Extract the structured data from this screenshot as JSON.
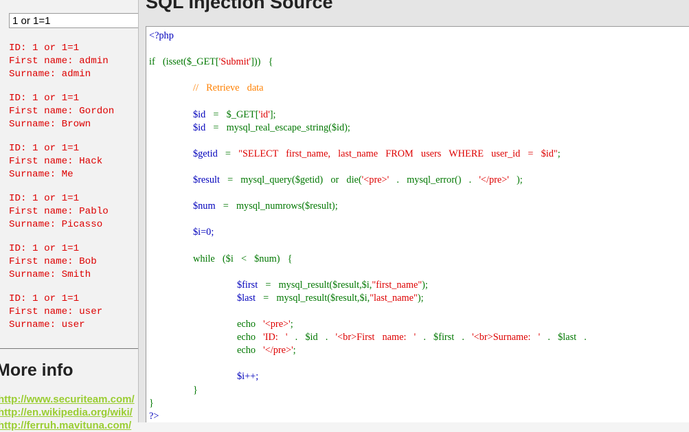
{
  "search": {
    "value": "1 or 1=1"
  },
  "results": [
    {
      "id": "ID: 1 or 1=1",
      "first": "First name: admin",
      "surname": "Surname: admin"
    },
    {
      "id": "ID: 1 or 1=1",
      "first": "First name: Gordon",
      "surname": "Surname: Brown"
    },
    {
      "id": "ID: 1 or 1=1",
      "first": "First name: Hack",
      "surname": "Surname: Me"
    },
    {
      "id": "ID: 1 or 1=1",
      "first": "First name: Pablo",
      "surname": "Surname: Picasso"
    },
    {
      "id": "ID: 1 or 1=1",
      "first": "First name: Bob",
      "surname": "Surname: Smith"
    },
    {
      "id": "ID: 1 or 1=1",
      "first": "First name: user",
      "surname": "Surname: user"
    }
  ],
  "more_info": {
    "heading": "More info",
    "links": [
      "http://www.securiteam.com/",
      "http://en.wikipedia.org/wiki/",
      "http://ferruh.mavituna.com/"
    ]
  },
  "popup": {
    "title": "SQL Injection Source",
    "code": {
      "php_open": "<?php",
      "if_kw": "if",
      "if_rest": "  (isset($_GET[",
      "submit_str": "'Submit'",
      "if_end": "]))  {",
      "comment": "//  Retrieve  data",
      "id1_var": "$id",
      "id1_mid": "  =  $_GET[",
      "id1_str": "'id'",
      "id1_end": "];",
      "id2_var": "$id",
      "id2_rest": "  =  mysql_real_escape_string($id);",
      "getid_var": "$getid",
      "getid_eq": "  =  ",
      "getid_str": "\"SELECT  first_name,  last_name  FROM  users  WHERE  user_id  =  $id\"",
      "getid_end": ";",
      "result_var": "$result",
      "result_mid": "  =  mysql_query($getid)  ",
      "result_or": "or",
      "result_die": "  die(",
      "result_pre": "'<pre>'",
      "result_concat": "  .  mysql_error()  .  ",
      "result_pre_close": "'</pre>'",
      "result_end": "  );",
      "num_var": "$num",
      "num_rest": "  =  mysql_numrows($result);",
      "i_init": "$i=0;",
      "while_kw": "while",
      "while_rest": "  ($i  <  $num)  {",
      "first_var": "$first",
      "first_mid": "  =  mysql_result($result,$i,",
      "first_str": "\"first_name\"",
      "first_end": ");",
      "last_var": "$last",
      "last_mid": "  =  mysql_result($result,$i,",
      "last_str": "\"last_name\"",
      "last_end": ");",
      "echo_kw": "echo",
      "echo1_str": "  '<pre>'",
      "echo1_end": ";",
      "echo2_str": "  'ID:  '",
      "echo2_a": "  .  $id  .  ",
      "echo2_str2": "'<br>First  name:  '",
      "echo2_b": "  .  $first  .  ",
      "echo2_str3": "'<br>Surname:  '",
      "echo2_end": "  .  $last  .  ",
      "echo3_str": "  '</pre>'",
      "echo3_end": ";",
      "incr": "$i++;",
      "close_brace": "}",
      "php_close": "?>"
    }
  }
}
